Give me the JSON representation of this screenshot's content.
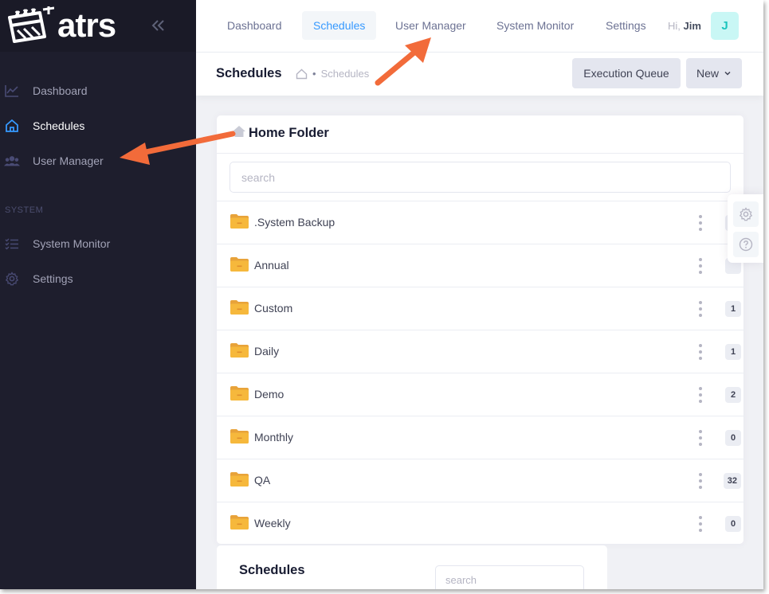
{
  "app": {
    "logo_text": "atrs"
  },
  "sidebar": {
    "items": [
      {
        "label": "Dashboard",
        "icon": "chart-line-icon"
      },
      {
        "label": "Schedules",
        "icon": "home-icon",
        "active": true
      },
      {
        "label": "User Manager",
        "icon": "users-icon"
      }
    ],
    "section_label": "SYSTEM",
    "system_items": [
      {
        "label": "System Monitor",
        "icon": "checklist-icon"
      },
      {
        "label": "Settings",
        "icon": "gear-icon"
      }
    ]
  },
  "topbar": {
    "tabs": [
      {
        "label": "Dashboard"
      },
      {
        "label": "Schedules",
        "active": true
      },
      {
        "label": "User Manager"
      },
      {
        "label": "System Monitor"
      },
      {
        "label": "Settings"
      }
    ],
    "greeting_prefix": "Hi,",
    "user_name": "Jim",
    "avatar_initial": "J"
  },
  "subheader": {
    "title": "Schedules",
    "breadcrumb_dot": "•",
    "breadcrumb_current": "Schedules",
    "execution_queue_label": "Execution Queue",
    "new_label": "New"
  },
  "folder_panel": {
    "title": "Home Folder",
    "search_placeholder": "search",
    "folders": [
      {
        "name": ".System Backup",
        "count": ""
      },
      {
        "name": "Annual",
        "count": ""
      },
      {
        "name": "Custom",
        "count": "1"
      },
      {
        "name": "Daily",
        "count": "1"
      },
      {
        "name": "Demo",
        "count": "2"
      },
      {
        "name": "Monthly",
        "count": "0"
      },
      {
        "name": "QA",
        "count": "32"
      },
      {
        "name": "Weekly",
        "count": "0"
      }
    ]
  },
  "schedules_panel": {
    "title": "Schedules",
    "search_placeholder": "search"
  },
  "colors": {
    "sidebar_bg": "#1e1e2d",
    "accent": "#3699ff",
    "annotation_arrow": "#f26b3a",
    "folder": "#f6b83c"
  }
}
